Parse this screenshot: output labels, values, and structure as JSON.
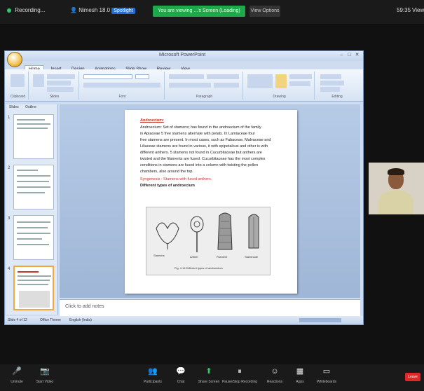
{
  "topbar": {
    "recording": "Recording...",
    "host_name": "Nimesh 18.0",
    "host_badge": "Spotlight",
    "viewing_banner": "You are viewing ...'s Screen  (Loading)",
    "view_options": "View Options",
    "clock": "59:35",
    "view_mode": "View"
  },
  "ppt": {
    "window_title": "Microsoft PowerPoint",
    "tabs": [
      "Home",
      "Insert",
      "Design",
      "Animations",
      "Slide Show",
      "Review",
      "View"
    ],
    "ribbon_groups": [
      "Clipboard",
      "Slides",
      "Font",
      "Paragraph",
      "Drawing",
      "Editing"
    ],
    "panel_tabs": [
      "Slides",
      "Outline"
    ],
    "thumb_numbers": [
      "1",
      "2",
      "3",
      "4"
    ],
    "notes_placeholder": "Click to add notes",
    "status": {
      "slide_info": "Slide 4 of 12",
      "theme": "Office Theme",
      "language": "English (India)"
    }
  },
  "slide": {
    "heading": "Androecium:",
    "lines": [
      "Androecium: Set of stamens; has found in the androecium of the family",
      "in Apiaceae 5 free stamens alternate with petals. In Lamiaceae four",
      "free stamens are present. In most cases, such as Fabaceae, Malvaceae and",
      "Liliaceae stamens are found in various, it with epipetalous and other is with",
      "different anthers. 5 stamens not found in Cucurbitaceae but anthers are",
      "twisted and the filaments are fused. Cucurbitaceae has the most complex",
      "conditions in stamens are fused into a column with twisting the pollen",
      "chambers, also around the top."
    ],
    "syngenesis_line": "Syngenesis : Stamens with fused anthers.",
    "figure_title": "Different types of androecium",
    "figure_labels": [
      "Stamens",
      "Anther",
      "Filament",
      "Staminode"
    ],
    "figure_caption": "Fig. 4.14 Different types of androecium"
  },
  "bottombar": {
    "items": [
      {
        "icon": "microphone-icon",
        "label": "Unmute",
        "glyph": "🎤"
      },
      {
        "icon": "video-icon",
        "label": "Start Video",
        "glyph": "📷"
      },
      {
        "icon": "participants-icon",
        "label": "Participants",
        "glyph": "👥"
      },
      {
        "icon": "chat-icon",
        "label": "Chat",
        "glyph": "💬"
      },
      {
        "icon": "share-screen-icon",
        "label": "Share Screen",
        "glyph": "⬆"
      },
      {
        "icon": "record-icon",
        "label": "Pause/Stop Recording",
        "glyph": "⏸"
      },
      {
        "icon": "reactions-icon",
        "label": "Reactions",
        "glyph": "☺"
      },
      {
        "icon": "apps-icon",
        "label": "Apps",
        "glyph": "▦"
      },
      {
        "icon": "whiteboard-icon",
        "label": "Whiteboards",
        "glyph": "▭"
      }
    ],
    "leave": "Leave"
  },
  "colors": {
    "zoom_green": "#1ea84a",
    "spotlight_blue": "#1e6fd9",
    "leave_red": "#e02828",
    "slide_heading_red": "#c0392b"
  }
}
